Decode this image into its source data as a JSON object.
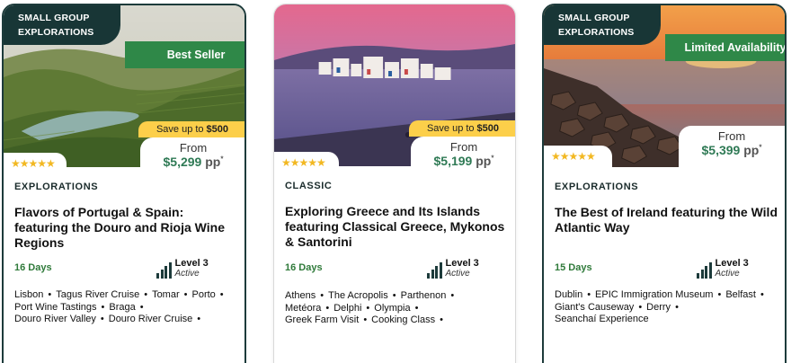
{
  "cards": [
    {
      "badge_line1": "SMALL GROUP",
      "badge_line2": "EXPLORATIONS",
      "ribbon": "Best Seller",
      "save_prefix": "Save up to",
      "save_amount": "$500",
      "price_from": "From",
      "price": "$5,299",
      "price_unit": "pp",
      "price_note": "*",
      "rating": "★★★★★",
      "category": "EXPLORATIONS",
      "title": "Flavors of Portugal & Spain: featuring the Douro and Rioja Wine Regions",
      "days": "16 Days",
      "level": "Level 3",
      "activity": "Active",
      "stops": [
        "Lisbon",
        "Tagus River Cruise",
        "Tomar",
        "Porto",
        "Port Wine Tastings",
        "Braga",
        "Douro River Valley",
        "Douro River Cruise"
      ]
    },
    {
      "save_prefix": "Save up to",
      "save_amount": "$500",
      "price_from": "From",
      "price": "$5,199",
      "price_unit": "pp",
      "price_note": "*",
      "rating": "★★★★★",
      "category": "CLASSIC",
      "title": "Exploring Greece and Its Islands featuring Classical Greece, Mykonos & Santorini",
      "days": "16 Days",
      "level": "Level 3",
      "activity": "Active",
      "stops": [
        "Athens",
        "The Acropolis",
        "Parthenon",
        "Metéora",
        "Delphi",
        "Olympia",
        "Greek Farm Visit",
        "Cooking Class"
      ]
    },
    {
      "badge_line1": "SMALL GROUP",
      "badge_line2": "EXPLORATIONS",
      "ribbon": "Limited Availability",
      "price_from": "From",
      "price": "$5,399",
      "price_unit": "pp",
      "price_note": "*",
      "rating": "★★★★★",
      "category": "EXPLORATIONS",
      "title": "The Best of Ireland featuring the Wild Atlantic Way",
      "days": "15 Days",
      "level": "Level 3",
      "activity": "Active",
      "stops": [
        "Dublin",
        "EPIC Immigration Museum",
        "Belfast",
        "Giant's Causeway",
        "Derry",
        "Seanchaí Experience"
      ]
    }
  ],
  "colors": {
    "badge_bg": "#183636",
    "ribbon_green": "#2f8848",
    "save_yellow": "#fccf4a",
    "price_green": "#2f7a55",
    "days_green": "#2f7a3a",
    "star_gold": "#f2b822"
  },
  "icons": [
    "signal-bars-icon",
    "star-icon"
  ]
}
